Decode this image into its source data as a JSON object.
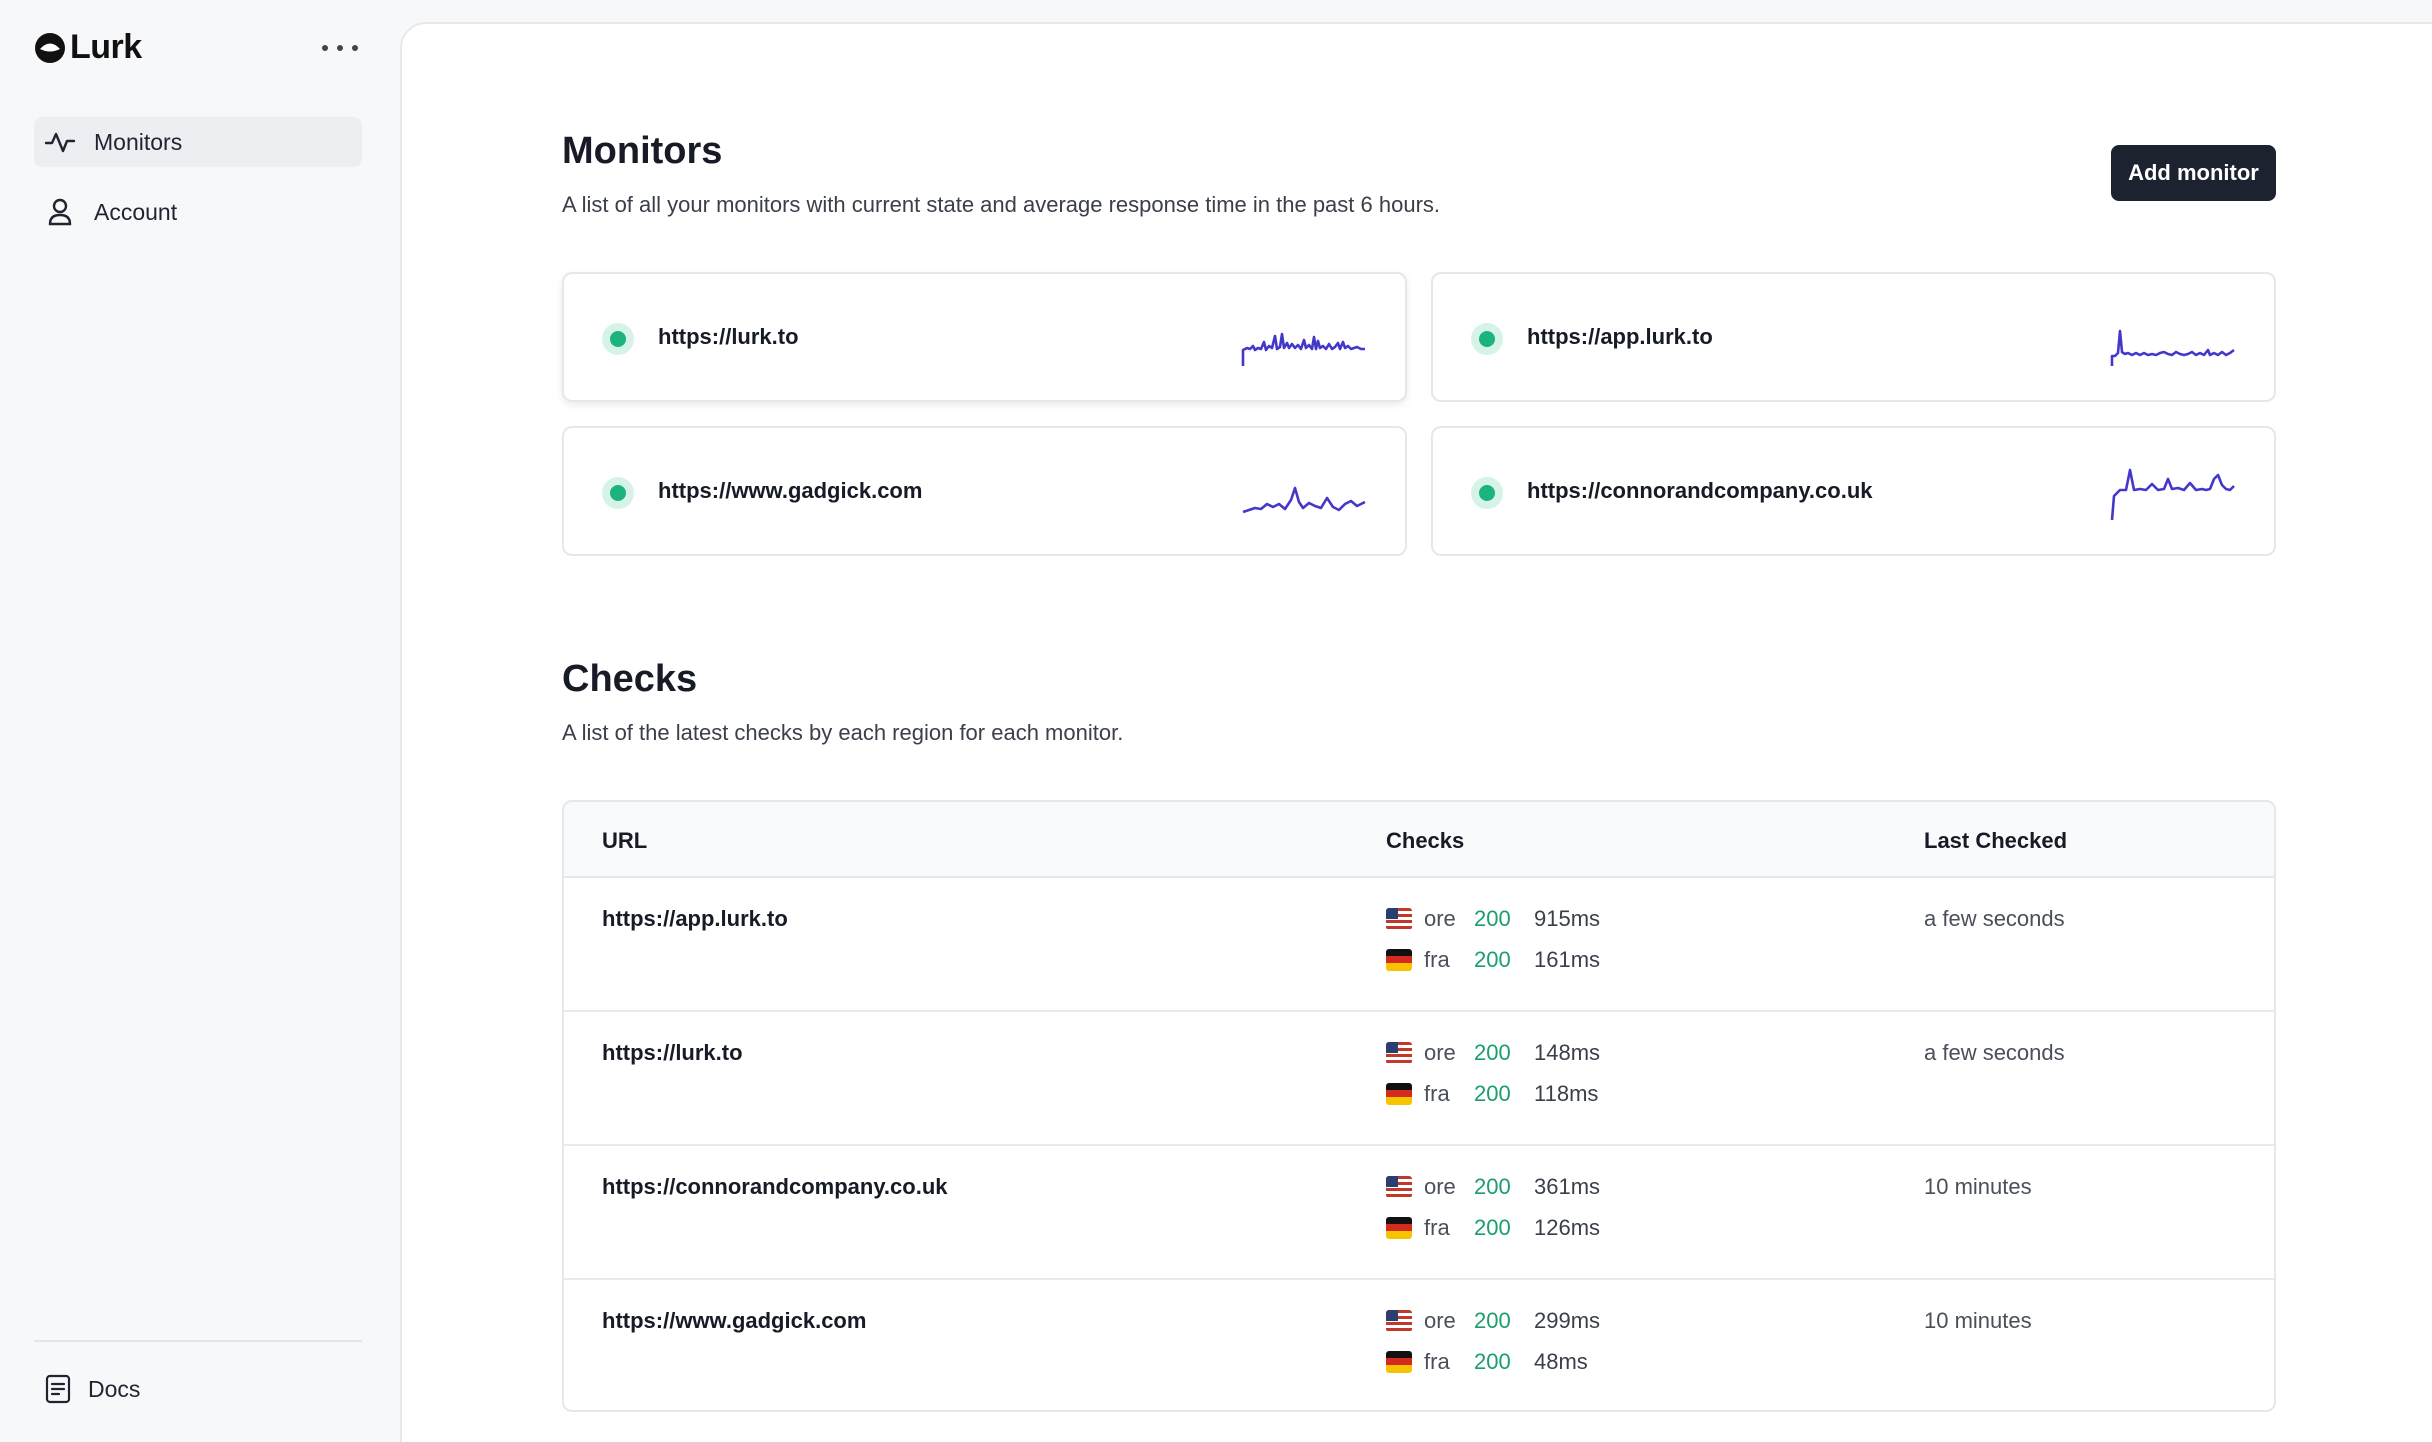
{
  "app": {
    "name": "Lurk"
  },
  "sidebar": {
    "items": [
      {
        "label": "Monitors",
        "icon": "activity-icon",
        "active": true
      },
      {
        "label": "Account",
        "icon": "user-icon",
        "active": false
      }
    ],
    "footer": {
      "label": "Docs",
      "icon": "document-icon"
    }
  },
  "monitors": {
    "title": "Monitors",
    "description": "A list of all your monitors with current state and average response time in the past 6 hours.",
    "add_label": "Add monitor",
    "status_color": "#1db37f",
    "sparkline_color": "#4338ca",
    "cards": [
      {
        "url": "https://lurk.to",
        "status": "up"
      },
      {
        "url": "https://app.lurk.to",
        "status": "up"
      },
      {
        "url": "https://www.gadgick.com",
        "status": "up"
      },
      {
        "url": "https://connorandcompany.co.uk",
        "status": "up"
      }
    ]
  },
  "checks": {
    "title": "Checks",
    "description": "A list of the latest checks by each region for each monitor.",
    "columns": [
      "URL",
      "Checks",
      "Last Checked"
    ],
    "rows": [
      {
        "url": "https://app.lurk.to",
        "checks": [
          {
            "flag": "us-flag-icon",
            "region": "ore",
            "status": "200",
            "time": "915ms"
          },
          {
            "flag": "de-flag-icon",
            "region": "fra",
            "status": "200",
            "time": "161ms"
          }
        ],
        "last": "a few seconds"
      },
      {
        "url": "https://lurk.to",
        "checks": [
          {
            "flag": "us-flag-icon",
            "region": "ore",
            "status": "200",
            "time": "148ms"
          },
          {
            "flag": "de-flag-icon",
            "region": "fra",
            "status": "200",
            "time": "118ms"
          }
        ],
        "last": "a few seconds"
      },
      {
        "url": "https://connorandcompany.co.uk",
        "checks": [
          {
            "flag": "us-flag-icon",
            "region": "ore",
            "status": "200",
            "time": "361ms"
          },
          {
            "flag": "de-flag-icon",
            "region": "fra",
            "status": "200",
            "time": "126ms"
          }
        ],
        "last": "10 minutes"
      },
      {
        "url": "https://www.gadgick.com",
        "checks": [
          {
            "flag": "us-flag-icon",
            "region": "ore",
            "status": "200",
            "time": "299ms"
          },
          {
            "flag": "de-flag-icon",
            "region": "fra",
            "status": "200",
            "time": "48ms"
          }
        ],
        "last": "10 minutes"
      }
    ]
  }
}
